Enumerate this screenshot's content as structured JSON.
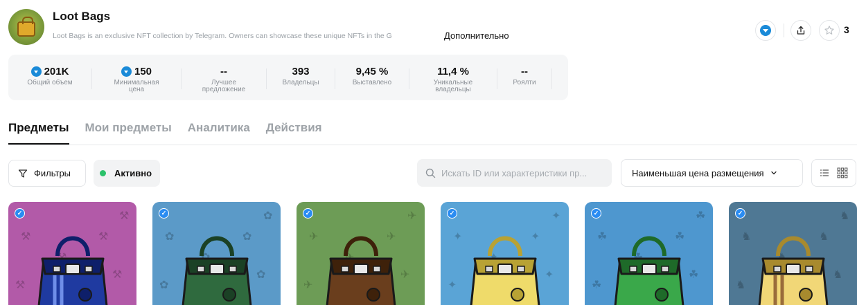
{
  "collection": {
    "title": "Loot Bags",
    "description": "Loot Bags is an exclusive NFT collection by Telegram. Owners can showcase these unique NFTs in the G",
    "more_label": "Дополнительно",
    "star_count": "3"
  },
  "stats": [
    {
      "value": "201K",
      "label": "Общий объем",
      "ton": true
    },
    {
      "value": "150",
      "label": "Минимальная цена",
      "ton": true
    },
    {
      "value": "--",
      "label": "Лучшее предложение",
      "ton": false
    },
    {
      "value": "393",
      "label": "Владельцы",
      "ton": false
    },
    {
      "value": "9,45 %",
      "label": "Выставлено",
      "ton": false
    },
    {
      "value": "11,4 %",
      "label": "Уникальные владельцы",
      "ton": false
    },
    {
      "value": "--",
      "label": "Роялти",
      "ton": false
    }
  ],
  "tabs": [
    {
      "label": "Предметы",
      "active": true
    },
    {
      "label": "Мои предметы",
      "active": false
    },
    {
      "label": "Аналитика",
      "active": false
    },
    {
      "label": "Действия",
      "active": false
    }
  ],
  "toolbar": {
    "filters_label": "Фильтры",
    "active_label": "Активно",
    "search_placeholder": "Искать ID или характеристики пр...",
    "sort_label": "Наименьшая цена размещения"
  },
  "cards": [
    {
      "bg": "#b25aa8",
      "bag": "#1f3aa0",
      "trim": "#0e1f6a",
      "stripe": "#6f8ee8",
      "symbol": "⚒"
    },
    {
      "bg": "#5b9ac8",
      "bag": "#2f6a3e",
      "trim": "#1b4125",
      "stripe": "",
      "symbol": "✿"
    },
    {
      "bg": "#6d9c56",
      "bag": "#6a3e1d",
      "trim": "#3e210a",
      "stripe": "",
      "symbol": "✈"
    },
    {
      "bg": "#5aa4d6",
      "bag": "#efdb6a",
      "trim": "#b8a234",
      "stripe": "",
      "symbol": "✦"
    },
    {
      "bg": "#4e97cf",
      "bag": "#3aa84a",
      "trim": "#1e6a29",
      "stripe": "",
      "symbol": "☘"
    },
    {
      "bg": "#4f7894",
      "bag": "#f1d777",
      "trim": "#a88a2e",
      "stripe": "#9a6c3a",
      "symbol": "♞"
    }
  ]
}
